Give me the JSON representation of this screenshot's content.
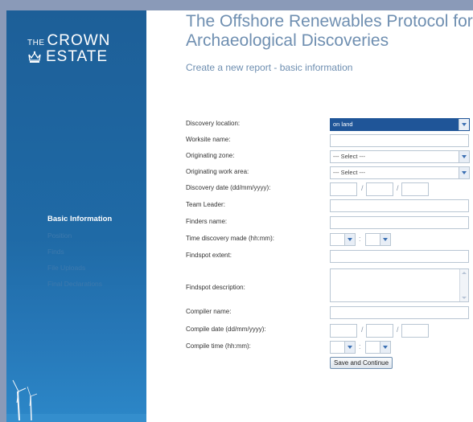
{
  "logo": {
    "line1_small": "THE",
    "line1_big": "CROWN",
    "line2": "ESTATE"
  },
  "nav": {
    "items": [
      {
        "label": "Basic Information",
        "active": true
      },
      {
        "label": "Position",
        "active": false
      },
      {
        "label": "Finds",
        "active": false
      },
      {
        "label": "File Uploads",
        "active": false
      },
      {
        "label": "Final Declarations",
        "active": false
      }
    ]
  },
  "page": {
    "title": "The Offshore Renewables Protocol for Archaeological Discoveries",
    "subtitle": "Create a new report - basic information"
  },
  "form": {
    "discovery_location": {
      "label": "Discovery location:",
      "value": "on land"
    },
    "worksite_name": {
      "label": "Worksite name:",
      "value": ""
    },
    "originating_zone": {
      "label": "Originating zone:",
      "value": "--- Select ---"
    },
    "originating_work_area": {
      "label": "Originating work area:",
      "value": "--- Select ---"
    },
    "discovery_date": {
      "label": "Discovery date (dd/mm/yyyy):",
      "sep": "/"
    },
    "team_leader": {
      "label": "Team Leader:",
      "value": ""
    },
    "finders_name": {
      "label": "Finders name:",
      "value": ""
    },
    "time_discovery": {
      "label": "Time discovery made (hh:mm):",
      "sep": ":"
    },
    "findspot_extent": {
      "label": "Findspot extent:",
      "value": ""
    },
    "findspot_description": {
      "label": "Findspot description:",
      "value": ""
    },
    "compiler_name": {
      "label": "Compiler name:",
      "value": ""
    },
    "compile_date": {
      "label": "Compile date (dd/mm/yyyy):",
      "sep": "/"
    },
    "compile_time": {
      "label": "Compile time (hh:mm):",
      "sep": ":"
    },
    "save_button": "Save and Continue"
  },
  "colors": {
    "sidebar": "#1f6aa6",
    "title": "#6f8fb1",
    "selected_dropdown": "#1f5598",
    "background": "#8a9ab8"
  }
}
